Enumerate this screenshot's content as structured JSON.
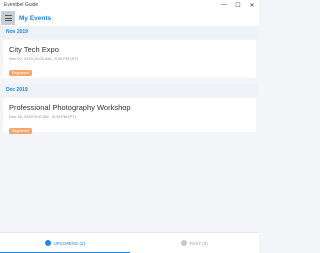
{
  "window": {
    "title": "Eventbel Guide",
    "minimize": "—",
    "maximize": "☐",
    "close": "✕"
  },
  "header": {
    "page_title": "My Events"
  },
  "sections": [
    {
      "month": "Nov 2019",
      "events": [
        {
          "title": "City Tech Expo",
          "time": "Nov 02, 2019 10:00 AM - 3:00 PM (PT)",
          "badge": "Registered"
        }
      ]
    },
    {
      "month": "Dec 2019",
      "events": [
        {
          "title": "Professional Photography Workshop",
          "time": "Dec 18, 2019 9:00 AM - 5:00 PM (PT)",
          "badge": "Registered"
        }
      ]
    }
  ],
  "tabs": {
    "upcoming": "UPCOMING (2)",
    "past": "PAST (0)"
  },
  "colors": {
    "accent": "#1e88e5",
    "badge": "#f5a66a"
  }
}
